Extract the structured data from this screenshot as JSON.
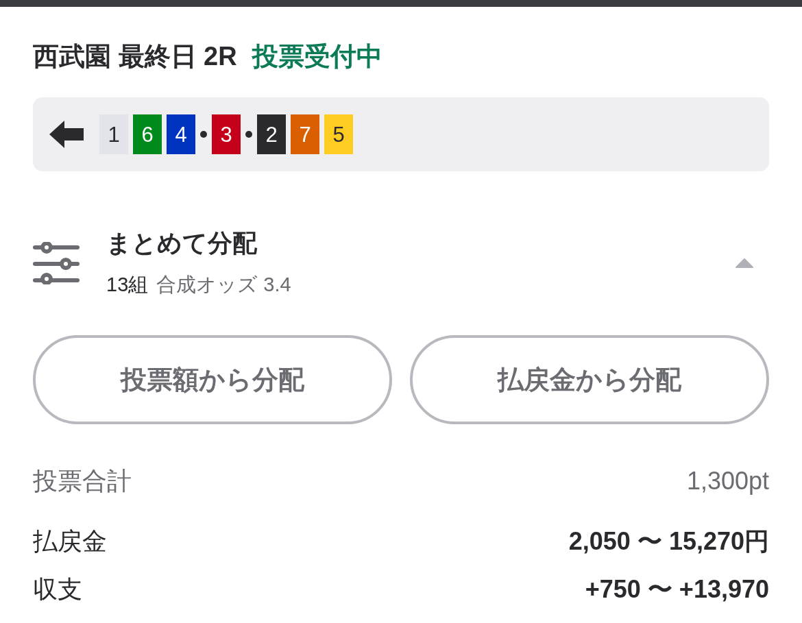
{
  "header": {
    "race": "西武園 最終日 2R",
    "status": "投票受付中"
  },
  "selection": {
    "groups": [
      {
        "tiles": [
          {
            "number": "1",
            "color": "#e3e4e9"
          },
          {
            "number": "6",
            "color": "#008a1c"
          },
          {
            "number": "4",
            "color": "#0033c0"
          }
        ]
      },
      {
        "tiles": [
          {
            "number": "3",
            "color": "#c4001a"
          }
        ]
      },
      {
        "tiles": [
          {
            "number": "2",
            "color": "#2a2a2e"
          },
          {
            "number": "7",
            "color": "#d95f00"
          },
          {
            "number": "5",
            "color": "#ffcc22"
          }
        ]
      }
    ]
  },
  "distribution": {
    "title": "まとめて分配",
    "count": "13組",
    "odds": "合成オッズ 3.4",
    "expanded": true
  },
  "buttons": [
    "投票額から分配",
    "払戻金から分配"
  ],
  "summary": [
    {
      "kind": "total",
      "label": "投票合計",
      "value": "1,300pt"
    },
    {
      "kind": "range",
      "label": "払戻金",
      "value": "2,050 〜 15,270円"
    },
    {
      "kind": "range",
      "label": "収支",
      "value": "+750 〜 +13,970"
    }
  ]
}
